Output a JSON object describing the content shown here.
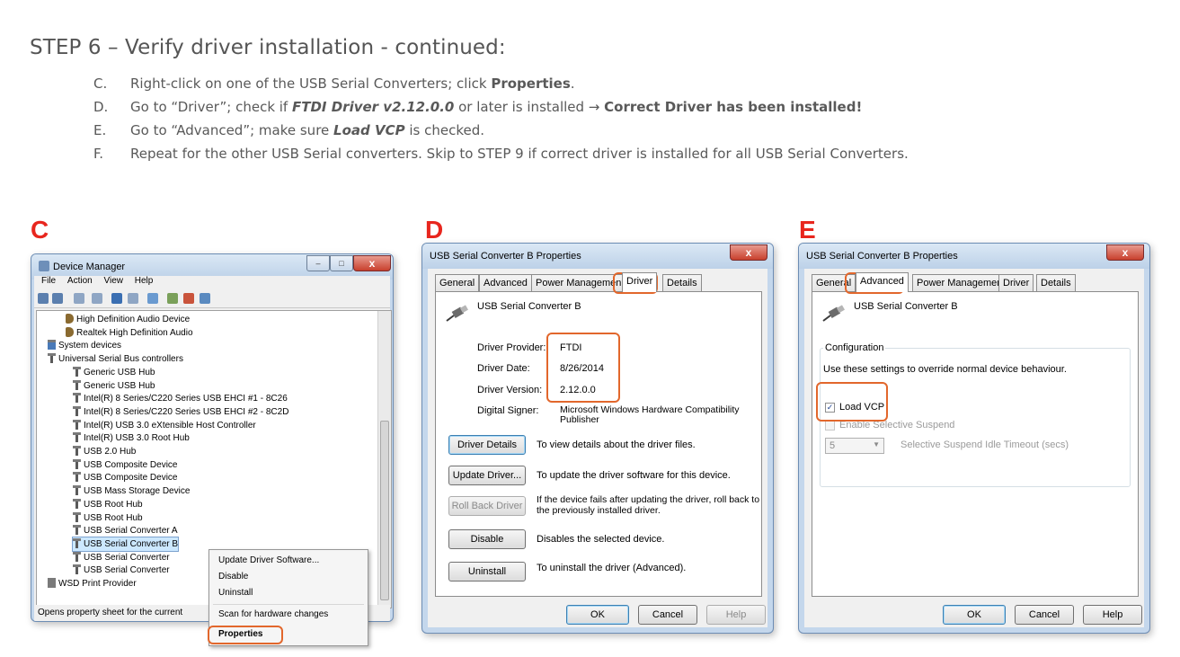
{
  "heading": "STEP 6 – Verify driver installation - continued:",
  "steps": [
    {
      "letter": "C.",
      "parts": [
        {
          "t": "Right-click on one of the USB Serial Converters; click ",
          "s": "n"
        },
        {
          "t": "Properties",
          "s": "b"
        },
        {
          "t": ".",
          "s": "n"
        }
      ]
    },
    {
      "letter": "D.",
      "parts": [
        {
          "t": "Go to “Driver”; check if ",
          "s": "n"
        },
        {
          "t": "FTDI Driver v2.12.0.0",
          "s": "bi"
        },
        {
          "t": " or later is installed → ",
          "s": "n"
        },
        {
          "t": "Correct Driver has been installed!",
          "s": "b"
        }
      ]
    },
    {
      "letter": "E.",
      "parts": [
        {
          "t": "Go to “Advanced”; make sure ",
          "s": "n"
        },
        {
          "t": "Load VCP",
          "s": "bi"
        },
        {
          "t": " is checked.",
          "s": "n"
        }
      ]
    },
    {
      "letter": "F.",
      "parts": [
        {
          "t": "Repeat for the other USB Serial converters. Skip to STEP 9 if correct driver is installed for all USB Serial Converters.",
          "s": "n"
        }
      ]
    }
  ],
  "panels": {
    "c": "C",
    "d": "D",
    "e": "E"
  },
  "devmgr": {
    "title": "Device Manager",
    "menu": [
      "File",
      "Action",
      "View",
      "Help"
    ],
    "tree": [
      "High Definition Audio Device",
      "Realtek High Definition Audio",
      "System devices",
      "Universal Serial Bus controllers",
      "Generic USB Hub",
      "Generic USB Hub",
      "Intel(R) 8 Series/C220 Series USB EHCI #1 - 8C26",
      "Intel(R) 8 Series/C220 Series USB EHCI #2 - 8C2D",
      "Intel(R) USB 3.0 eXtensible Host Controller",
      "Intel(R) USB 3.0 Root Hub",
      "USB 2.0 Hub",
      "USB Composite Device",
      "USB Composite Device",
      "USB Mass Storage Device",
      "USB Root Hub",
      "USB Root Hub",
      "USB Serial Converter A",
      "USB Serial Converter B",
      "USB Serial Converter",
      "USB Serial Converter",
      "WSD Print Provider"
    ],
    "status": "Opens property sheet for the current",
    "context_menu": [
      "Update Driver Software...",
      "Disable",
      "Uninstall",
      "Scan for hardware changes",
      "Properties"
    ]
  },
  "driver_dialog": {
    "title": "USB Serial Converter B Properties",
    "close": "x",
    "tabs": [
      "General",
      "Advanced",
      "Power Managemen",
      "Driver",
      "Details"
    ],
    "device_name": "USB Serial Converter B",
    "provider_label": "Driver Provider:",
    "provider": "FTDI",
    "date_label": "Driver Date:",
    "date": "8/26/2014",
    "version_label": "Driver Version:",
    "version": "2.12.0.0",
    "signer_label": "Digital Signer:",
    "signer": "Microsoft Windows Hardware Compatibility Publisher",
    "actions": [
      {
        "button": "Driver Details",
        "desc": "To view details about the driver files."
      },
      {
        "button": "Update Driver...",
        "desc": "To update the driver software for this device."
      },
      {
        "button": "Roll Back Driver",
        "desc": "If the device fails after updating the driver, roll back to the previously installed driver."
      },
      {
        "button": "Disable",
        "desc": "Disables the selected device."
      },
      {
        "button": "Uninstall",
        "desc": "To uninstall the driver (Advanced)."
      }
    ],
    "ok": "OK",
    "cancel": "Cancel",
    "help": "Help"
  },
  "advanced_dialog": {
    "title": "USB Serial Converter B Properties",
    "close": "x",
    "tabs": [
      "General",
      "Advanced",
      "Power Management",
      "Driver",
      "Details"
    ],
    "device_name": "USB Serial Converter B",
    "group_title": "Configuration",
    "group_desc": "Use these settings to override normal device behaviour.",
    "load_vcp": "Load VCP",
    "load_vcp_checked": true,
    "selective_suspend": "Enable Selective Suspend",
    "timeout_value": "5",
    "timeout_label": "Selective Suspend Idle Timeout (secs)",
    "ok": "OK",
    "cancel": "Cancel",
    "help": "Help"
  },
  "colors": {
    "highlight": "#e2672c",
    "panel_letter": "#e8261e",
    "text": "#595959"
  }
}
